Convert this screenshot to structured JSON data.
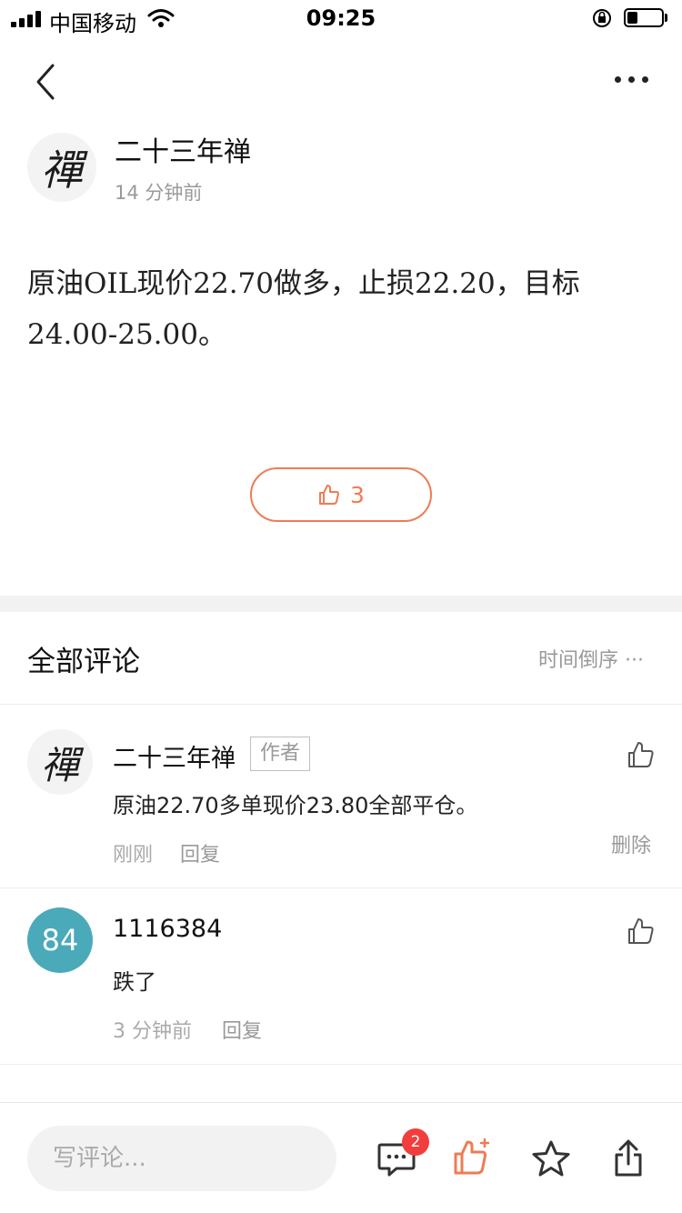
{
  "status_bar": {
    "carrier": "中国移动",
    "time": "09:25"
  },
  "nav": {
    "back_icon": "chevron-left-icon",
    "more_icon": "more-horizontal-icon"
  },
  "post": {
    "author_avatar_glyph": "禪",
    "author_name": "二十三年禅",
    "time": "14 分钟前",
    "content": "原油OIL现价22.70做多，止损22.20，目标24.00-25.00。",
    "like_count": "3"
  },
  "comments": {
    "title": "全部评论",
    "sort_label": "时间倒序",
    "items": [
      {
        "avatar_glyph": "禪",
        "name": "二十三年禅",
        "tag": "作者",
        "text": "原油22.70多单现价23.80全部平仓。",
        "time": "刚刚",
        "reply": "回复",
        "delete": "删除"
      },
      {
        "avatar_text": "84",
        "name": "1116384",
        "text": "跌了",
        "time": "3 分钟前",
        "reply": "回复"
      }
    ]
  },
  "bottom_bar": {
    "input_placeholder": "写评论...",
    "comment_badge": "2",
    "accent_color": "#ee7c54",
    "badge_color": "#f23d3d"
  }
}
